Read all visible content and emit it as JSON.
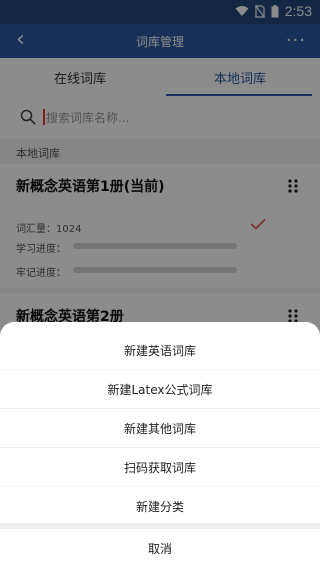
{
  "status_bar": {
    "time": "2:53"
  },
  "app_bar": {
    "title": "词库管理"
  },
  "tabs": [
    {
      "label": "在线词库",
      "active": false
    },
    {
      "label": "本地词库",
      "active": true
    }
  ],
  "search": {
    "placeholder": "搜索词库名称..."
  },
  "section_label": "本地词库",
  "cards": [
    {
      "name": "新概念英语第1册(当前)",
      "vocab_label": "词汇量：1024",
      "study_label": "学习进度：",
      "memory_label": "牢记进度：",
      "selected": true
    },
    {
      "name": "新概念英语第2册"
    }
  ],
  "action_sheet": {
    "items": [
      "新建英语词库",
      "新建Latex公式词库",
      "新建其他词库",
      "扫码获取词库",
      "新建分类"
    ],
    "cancel": "取消"
  },
  "colors": {
    "status_bar": "#24487d",
    "app_bar": "#2a5aa2",
    "accent": "#2a5aa2",
    "check": "#d9534f"
  }
}
